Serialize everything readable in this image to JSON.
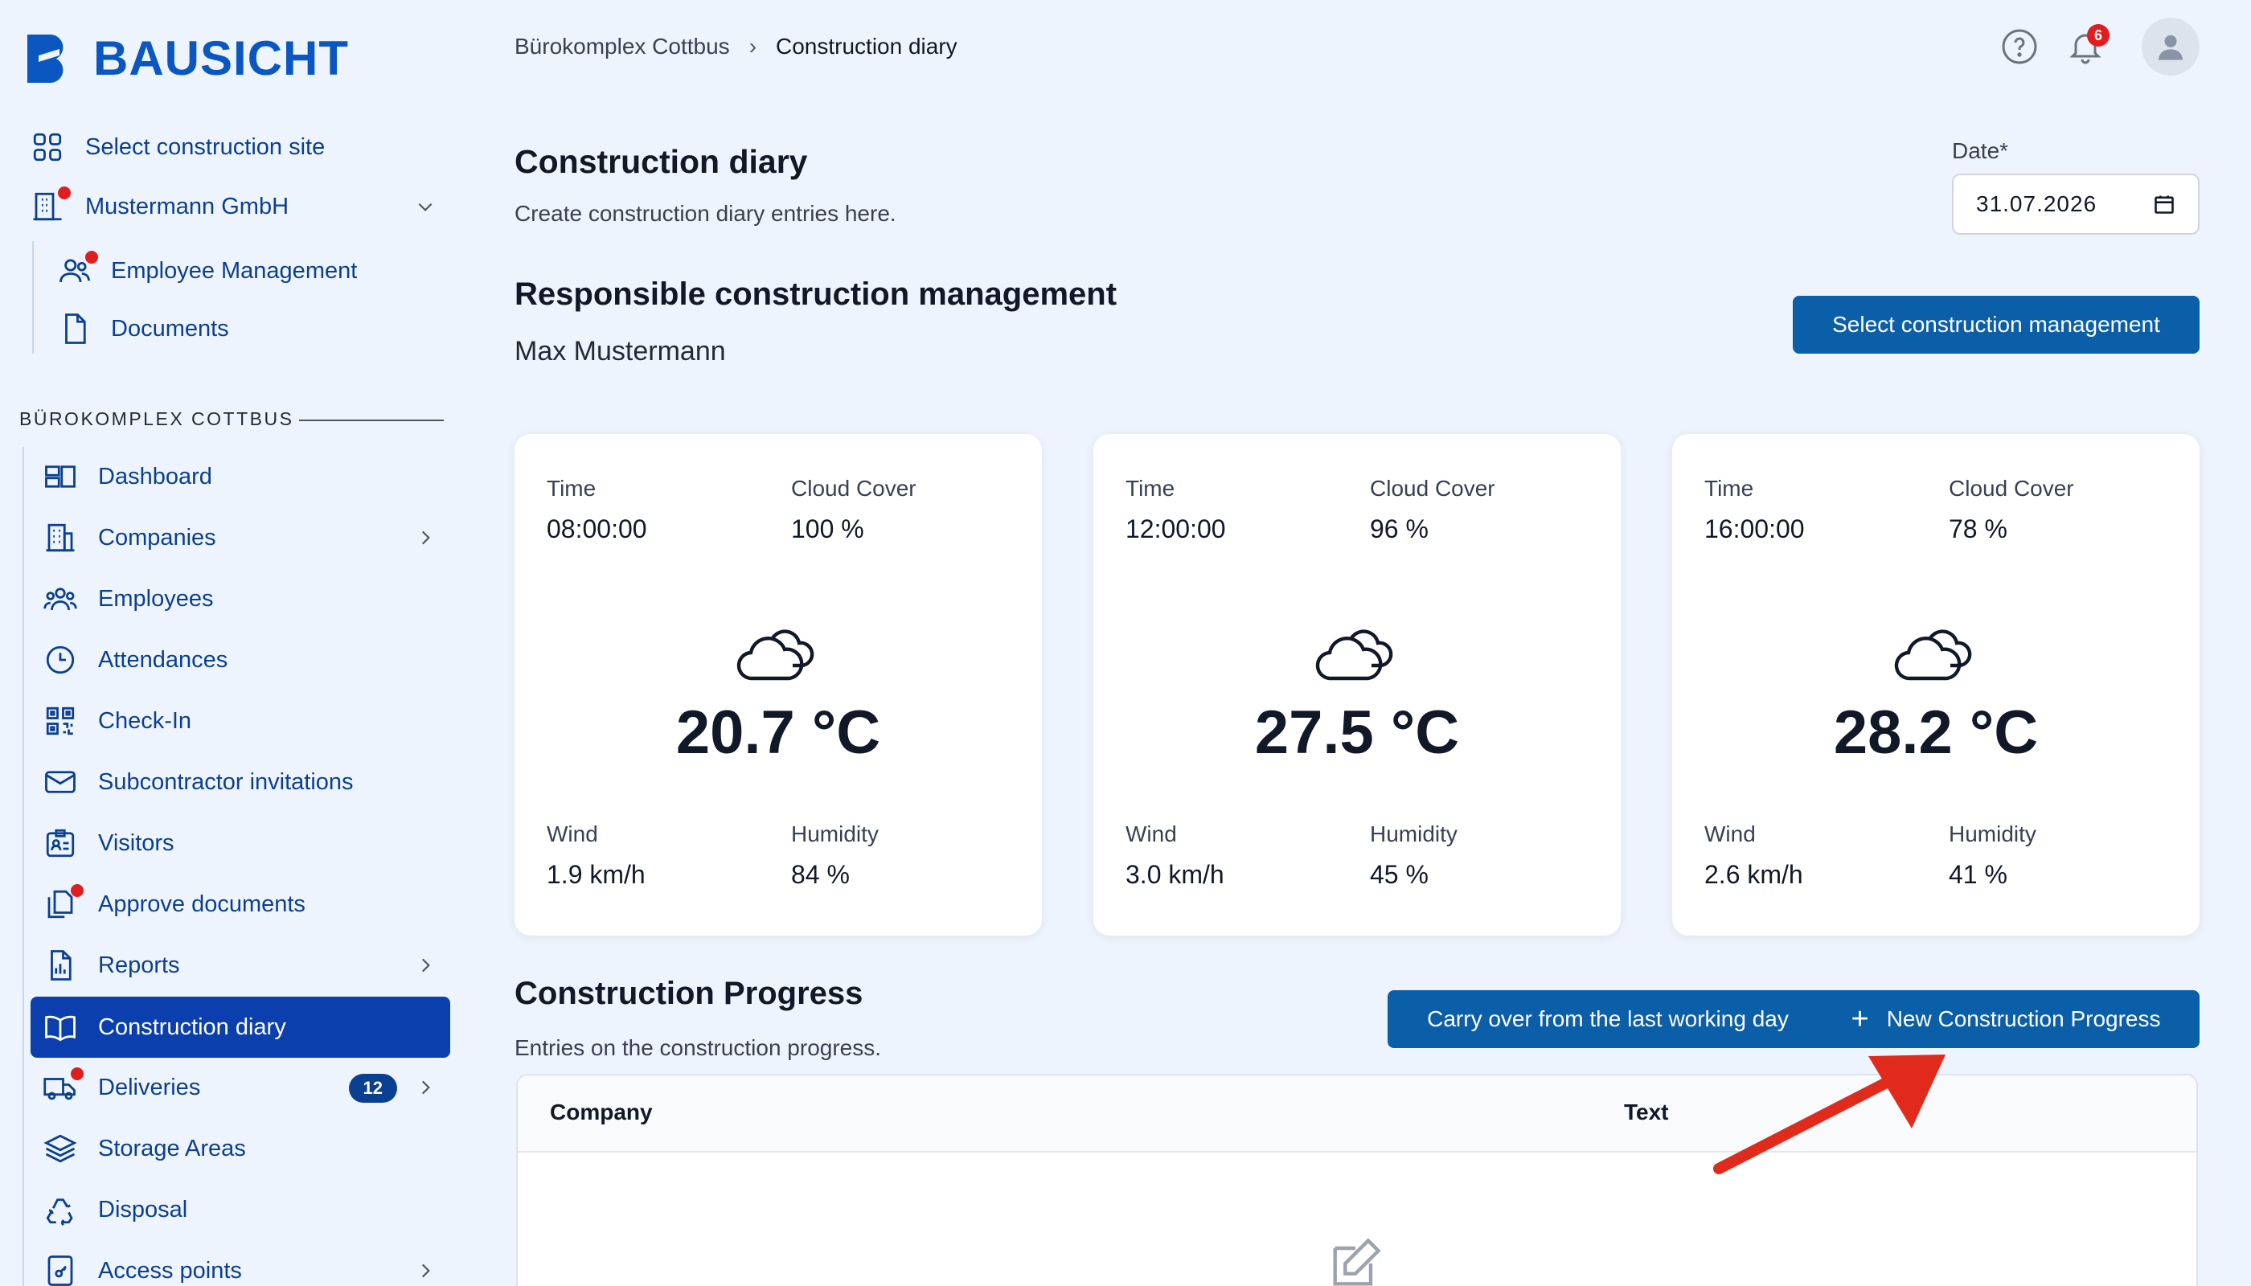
{
  "brand": {
    "name": "BAUSICHT"
  },
  "sidebar": {
    "select_site": "Select construction site",
    "company": "Mustermann GmbH",
    "company_items": [
      {
        "label": "Employee Management"
      },
      {
        "label": "Documents"
      }
    ],
    "section_label": "BÜROKOMPLEX COTTBUS",
    "items": [
      {
        "label": "Dashboard"
      },
      {
        "label": "Companies"
      },
      {
        "label": "Employees"
      },
      {
        "label": "Attendances"
      },
      {
        "label": "Check-In"
      },
      {
        "label": "Subcontractor invitations"
      },
      {
        "label": "Visitors"
      },
      {
        "label": "Approve documents"
      },
      {
        "label": "Reports"
      },
      {
        "label": "Construction diary"
      },
      {
        "label": "Deliveries",
        "badge": "12"
      },
      {
        "label": "Storage Areas"
      },
      {
        "label": "Disposal"
      },
      {
        "label": "Access points"
      }
    ]
  },
  "header": {
    "breadcrumb": {
      "site": "Bürokomplex Cottbus",
      "separator": "›",
      "current": "Construction diary"
    },
    "notifications_count": "6"
  },
  "page": {
    "title": "Construction diary",
    "subtitle": "Create construction diary entries here.",
    "date_label": "Date*",
    "date_value": "31.07.2026",
    "responsible_title": "Responsible construction management",
    "responsible_name": "Max Mustermann",
    "select_management_button": "Select construction management"
  },
  "weather": [
    {
      "time_label": "Time",
      "time": "08:00:00",
      "cloud_label": "Cloud Cover",
      "cloud": "100 %",
      "temp": "20.7 °C",
      "wind_label": "Wind",
      "wind": "1.9 km/h",
      "humidity_label": "Humidity",
      "humidity": "84 %",
      "icon": "cloud-icon"
    },
    {
      "time_label": "Time",
      "time": "12:00:00",
      "cloud_label": "Cloud Cover",
      "cloud": "96 %",
      "temp": "27.5 °C",
      "wind_label": "Wind",
      "wind": "3.0 km/h",
      "humidity_label": "Humidity",
      "humidity": "45 %",
      "icon": "cloud-icon"
    },
    {
      "time_label": "Time",
      "time": "16:00:00",
      "cloud_label": "Cloud Cover",
      "cloud": "78 %",
      "temp": "28.2 °C",
      "wind_label": "Wind",
      "wind": "2.6 km/h",
      "humidity_label": "Humidity",
      "humidity": "41 %",
      "icon": "cloud-icon"
    }
  ],
  "progress": {
    "title": "Construction Progress",
    "subtitle": "Entries on the construction progress.",
    "carry_button": "Carry over from the last working day",
    "new_button": "New Construction Progress",
    "new_button_icon": "plus",
    "columns": [
      "Company",
      "Text"
    ]
  },
  "colors": {
    "background": "#eef4fd",
    "brand": "#0b57c2",
    "active_nav": "#0b3fae",
    "button": "#0b5ea8",
    "alert": "#e11d1d",
    "annotation_arrow": "#e02a1b"
  }
}
